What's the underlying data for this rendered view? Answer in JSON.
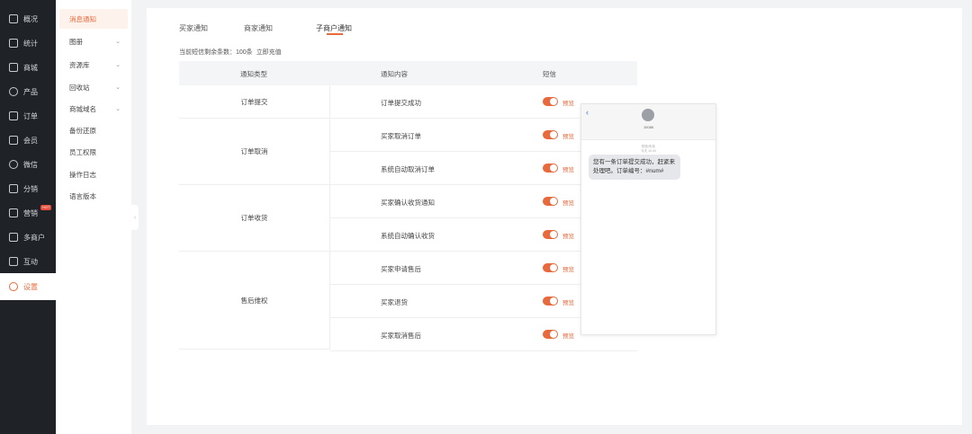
{
  "sidebar": {
    "items": [
      {
        "label": "概况",
        "icon": "grid-icon"
      },
      {
        "label": "统计",
        "icon": "chart-icon"
      },
      {
        "label": "商城",
        "icon": "shop-icon"
      },
      {
        "label": "产品",
        "icon": "box-icon"
      },
      {
        "label": "订单",
        "icon": "order-icon"
      },
      {
        "label": "会员",
        "icon": "crown-icon"
      },
      {
        "label": "微信",
        "icon": "wechat-icon"
      },
      {
        "label": "分销",
        "icon": "share-icon"
      },
      {
        "label": "营销",
        "icon": "gift-icon",
        "badge": "HOT"
      },
      {
        "label": "多商户",
        "icon": "store-icon"
      },
      {
        "label": "互动",
        "icon": "interact-icon"
      },
      {
        "label": "设置",
        "icon": "settings-icon",
        "active": true
      }
    ]
  },
  "subnav": {
    "items": [
      {
        "label": "消息通知",
        "active": true
      },
      {
        "label": "图册",
        "chevron": true
      },
      {
        "label": "资源库",
        "chevron": true
      },
      {
        "label": "回收站",
        "chevron": true
      },
      {
        "label": "商城域名",
        "chevron": true
      },
      {
        "label": "备份还原"
      },
      {
        "label": "员工权限"
      },
      {
        "label": "操作日志"
      },
      {
        "label": "语言版本"
      }
    ]
  },
  "tabs": [
    {
      "label": "买家通知"
    },
    {
      "label": "商家通知"
    },
    {
      "label": "子商户通知",
      "active": true
    }
  ],
  "sms_remaining": {
    "text": "当前短信剩余条数：100条",
    "link": "立即充值"
  },
  "table": {
    "headers": [
      "通知类型",
      "通知内容",
      "短信"
    ],
    "groups": [
      {
        "type": "订单提交",
        "rows": [
          "订单提交成功"
        ]
      },
      {
        "type": "订单取消",
        "rows": [
          "买家取消订单",
          "系统自动取消订单"
        ]
      },
      {
        "type": "订单收货",
        "rows": [
          "买家确认收货通知",
          "系统自动确认收货"
        ]
      },
      {
        "type": "售后维权",
        "rows": [
          "买家申请售后",
          "买家退货",
          "买家取消售后"
        ]
      }
    ],
    "toggle_on": true,
    "preview_label": "预览"
  },
  "phone_preview": {
    "sender": "10086",
    "meta": "短信/彩信",
    "date": "今天 10:44",
    "message": "您有一条订单提交成功，赶紧来处理吧。订单编号：#num#"
  },
  "colors": {
    "accent": "#e8693b",
    "sidebar_bg": "#1f2227"
  }
}
